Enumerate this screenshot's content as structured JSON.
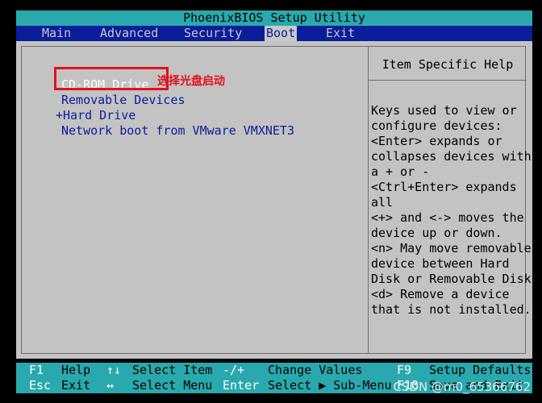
{
  "title": "PhoenixBIOS Setup Utility",
  "menu": [
    "Main",
    "Advanced",
    "Security",
    "Boot",
    "Exit"
  ],
  "active_menu": "Boot",
  "boot_items": [
    "CD-ROM Drive",
    "Removable Devices",
    "+Hard Drive",
    "Network boot from VMware VMXNET3"
  ],
  "annotation": "选择光盘启动",
  "help_title": "Item Specific Help",
  "help_lines": [
    "Keys used to view or",
    "configure devices:",
    "<Enter> expands or",
    "collapses devices with",
    "a + or -",
    "<Ctrl+Enter> expands",
    "all",
    "<+> and <-> moves the",
    "device up or down.",
    "<n> May move removable",
    "device between Hard",
    "Disk or Removable Disk",
    "<d> Remove a device",
    "that is not installed."
  ],
  "status": {
    "row1": {
      "k1": "F1",
      "a1": "Help",
      "k2": "↑↓",
      "a2": "Select Item",
      "k3": "-/+",
      "a3": "Change Values",
      "k4": "F9",
      "a4": "Setup Defaults"
    },
    "row2": {
      "k1": "Esc",
      "a1": "Exit",
      "k2": "↔",
      "a2": "Select Menu",
      "k3": "Enter",
      "a3": "Select ▶ Sub-Menu",
      "k4": "F10",
      "a4": "Save and Exit"
    }
  },
  "watermark": "CSDN @m0_65366762",
  "colors": {
    "menu_bg": "#0b1d9a",
    "bar_bg": "#29a9ad",
    "panel_bg": "#c3c3c3",
    "annotation": "#e0111b"
  }
}
